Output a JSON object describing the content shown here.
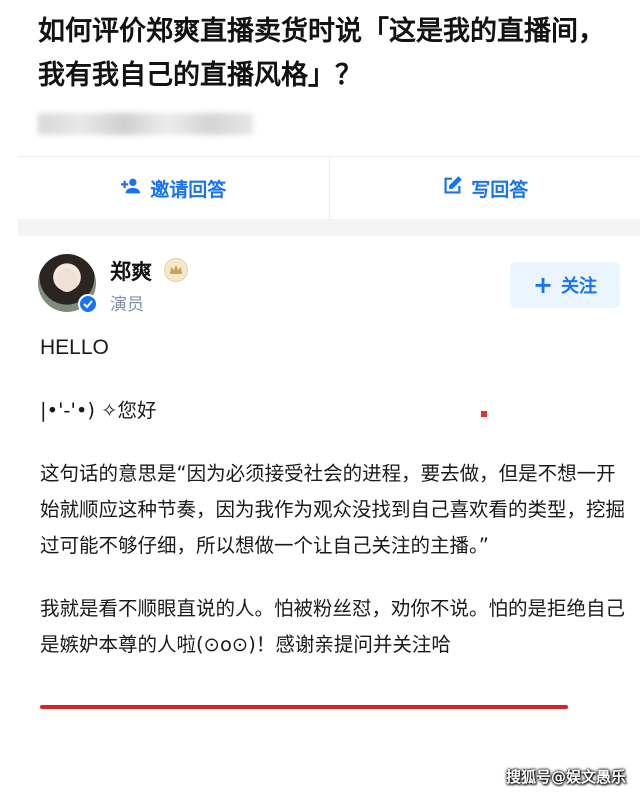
{
  "question": {
    "title": "如何评价郑爽直播卖货时说「这是我的直播间，我有我自己的直播风格」？"
  },
  "actions": {
    "invite_label": "邀请回答",
    "write_label": "写回答"
  },
  "author": {
    "name": "郑爽",
    "description": "演员",
    "follow_label": "关注"
  },
  "answer": {
    "paragraphs": [
      "HELLO",
      "|•'-'•) ✧您好",
      "这句话的意思是“因为必须接受社会的进程，要去做，但是不想一开始就顺应这种节奏，因为我作为观众没找到自己喜欢看的类型，挖掘过可能不够仔细，所以想做一个让自己关注的主播。”",
      "我就是看不顺眼直说的人。怕被粉丝怼，劝你不说。怕的是拒绝自己是嫉妒本尊的人啦(⊙o⊙)！感谢亲提问并关注哈"
    ]
  },
  "watermark": "搜狐号@娱文愚乐",
  "colors": {
    "accent": "#1772f6",
    "underline": "#e02020",
    "muted": "#8590a6"
  }
}
